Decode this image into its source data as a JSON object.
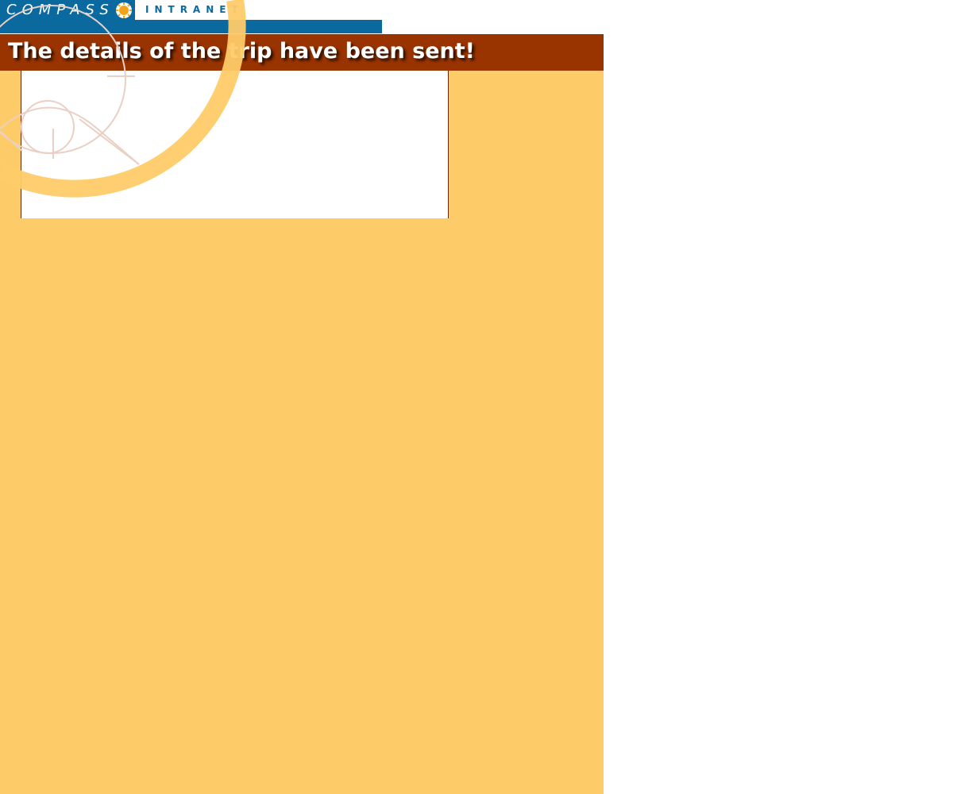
{
  "header": {
    "logo_compass_text": "COMPASS",
    "logo_intranet_text": "INTRANET"
  },
  "page": {
    "title": "The details of the trip have been sent!"
  },
  "colors": {
    "brand_blue": "#0a6aa0",
    "title_bar": "#993300",
    "content_background": "#fecb69",
    "panel_background": "#ffffff"
  },
  "icons": {
    "logo_mark": "compass-sun-icon",
    "background_decoration": "compass-rose-decoration"
  }
}
